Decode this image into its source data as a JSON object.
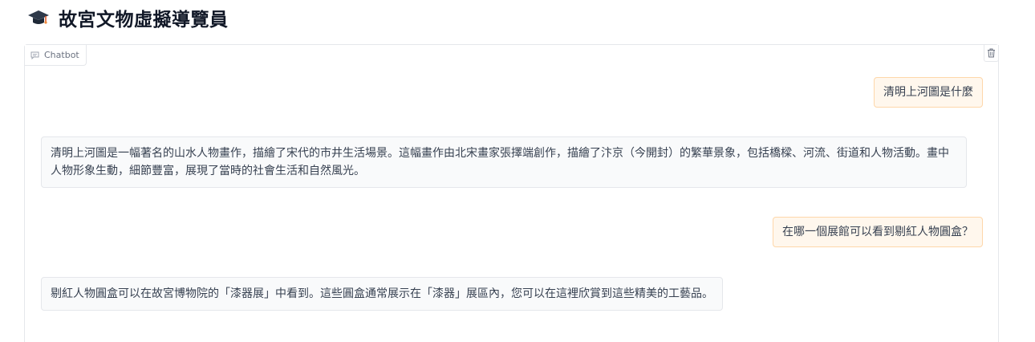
{
  "header": {
    "title": "故宮文物虛擬導覽員",
    "icon": "graduation-cap-icon"
  },
  "chatbot": {
    "label": "Chatbot",
    "label_icon": "chat-bubble-icon",
    "clear_icon": "trash-icon",
    "messages": [
      {
        "role": "user",
        "text": "清明上河圖是什麼"
      },
      {
        "role": "bot",
        "text": "清明上河圖是一幅著名的山水人物畫作，描繪了宋代的市井生活場景。這幅畫作由北宋畫家張擇端創作，描繪了汴京（今開封）的繁華景象，包括橋樑、河流、街道和人物活動。畫中人物形象生動，細節豐富，展現了當時的社會生活和自然風光。"
      },
      {
        "role": "user",
        "text": "在哪一個展館可以看到剔紅人物圓盒？"
      },
      {
        "role": "bot",
        "text": "剔紅人物圓盒可以在故宮博物院的「漆器展」中看到。這些圓盒通常展示在「漆器」展區內，您可以在這裡欣賞到這些精美的工藝品。"
      }
    ]
  },
  "colors": {
    "user_bubble_bg": "#fff7ed",
    "user_bubble_border": "#fed7aa",
    "bot_bubble_bg": "#f9fafb",
    "bot_bubble_border": "#e5e7eb"
  }
}
